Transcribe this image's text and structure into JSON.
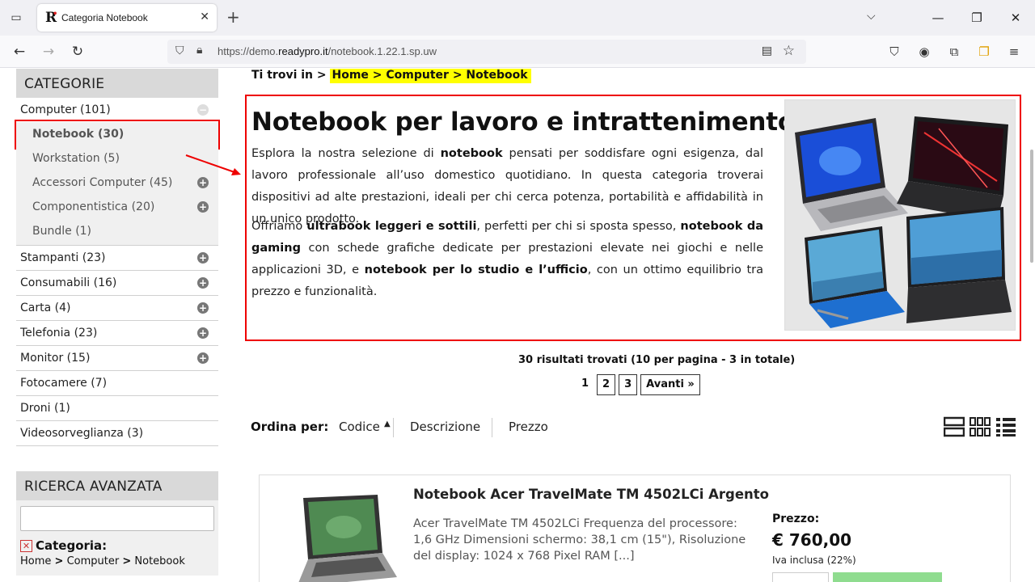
{
  "browser": {
    "tab_title": "Categoria Notebook",
    "url_prefix": "https://demo.",
    "url_domain": "readypro.it",
    "url_path": "/notebook.1.22.1.sp.uw"
  },
  "sidebar": {
    "categories_title": "CATEGORIE",
    "items": [
      {
        "label": "Computer (101)"
      },
      {
        "label": "Notebook (30)"
      },
      {
        "label": "Workstation (5)"
      },
      {
        "label": "Accessori Computer (45)"
      },
      {
        "label": "Componentistica (20)"
      },
      {
        "label": "Bundle (1)"
      },
      {
        "label": "Stampanti (23)"
      },
      {
        "label": "Consumabili (16)"
      },
      {
        "label": "Carta (4)"
      },
      {
        "label": "Telefonia (23)"
      },
      {
        "label": "Monitor (15)"
      },
      {
        "label": "Fotocamere (7)"
      },
      {
        "label": "Droni (1)"
      },
      {
        "label": "Videosorveglianza (3)"
      }
    ],
    "search_title": "RICERCA AVANZATA",
    "filter_label": "Categoria:",
    "filter_path": [
      "Home",
      "Computer",
      "Notebook"
    ]
  },
  "breadcrumb": {
    "prefix": "Ti trovi in >",
    "path": "Home > Computer > Notebook"
  },
  "intro": {
    "title": "Notebook per lavoro e intrattenimento",
    "p1": [
      {
        "t": "Esplora la nostra selezione di ",
        "b": false
      },
      {
        "t": "notebook",
        "b": true
      },
      {
        "t": " pensati per soddisfare ogni esigenza, dal lavoro professionale all’uso domestico quotidiano. In questa categoria troverai dispositivi ad alte prestazioni, ideali per chi cerca potenza, portabilità e affidabilità in un unico prodotto.",
        "b": false
      }
    ],
    "p2": [
      {
        "t": "Offriamo ",
        "b": false
      },
      {
        "t": "ultrabook leggeri e sottili",
        "b": true
      },
      {
        "t": ", perfetti per chi si sposta spesso, ",
        "b": false
      },
      {
        "t": "notebook da gaming",
        "b": true
      },
      {
        "t": " con schede grafiche dedicate per prestazioni elevate nei giochi e nelle applicazioni 3D, e ",
        "b": false
      },
      {
        "t": "notebook per lo studio e l’ufficio",
        "b": true
      },
      {
        "t": ", con un ottimo equilibrio tra prezzo e funzionalità.",
        "b": false
      }
    ]
  },
  "results": {
    "summary": "30 risultati trovati (10 per pagina - 3 in totale)",
    "pages": [
      "1",
      "2",
      "3"
    ],
    "next": "Avanti »"
  },
  "sort": {
    "label": "Ordina per:",
    "options": [
      "Codice",
      "Descrizione",
      "Prezzo"
    ]
  },
  "product": {
    "name": "Notebook Acer TravelMate TM 4502LCi Argento",
    "description": "Acer TravelMate TM 4502LCi Frequenza del processore: 1,6 GHz Dimensioni schermo: 38,1 cm (15\"), Risoluzione del display: 1024 x 768 Pixel RAM [...]",
    "price_label": "Prezzo:",
    "price": "€ 760,00",
    "vat": "Iva inclusa (22%)"
  }
}
